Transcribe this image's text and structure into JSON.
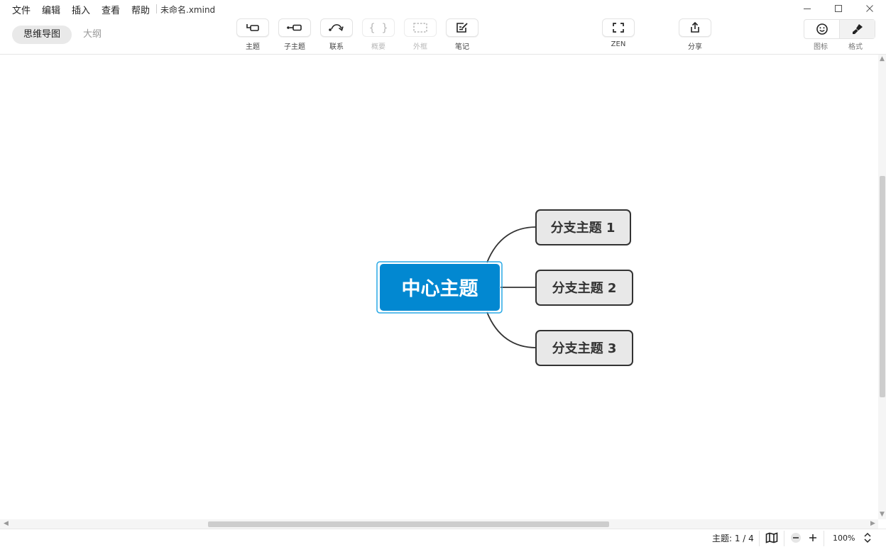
{
  "menu": {
    "items": [
      "文件",
      "编辑",
      "插入",
      "查看",
      "帮助"
    ],
    "doc_title": "未命名.xmind"
  },
  "window_controls": {
    "minimize": "minimize-icon",
    "maximize": "maximize-icon",
    "close": "close-icon"
  },
  "views": {
    "mindmap": "思维导图",
    "outline": "大纲"
  },
  "toolbar": {
    "topic": "主题",
    "subtopic": "子主题",
    "relationship": "联系",
    "summary": "概要",
    "boundary": "外框",
    "notes": "笔记",
    "zen": "ZEN",
    "share": "分享",
    "icons": "图标",
    "format": "格式"
  },
  "mindmap": {
    "central_topic": "中心主题",
    "central_color": "#0288d1",
    "branches": [
      "分支主题 1",
      "分支主题 2",
      "分支主题 3"
    ],
    "branch_fill": "#e8e8e8",
    "branch_border": "#333333"
  },
  "status": {
    "topic_count_label": "主题: 1 / 4",
    "zoom": "100%"
  }
}
